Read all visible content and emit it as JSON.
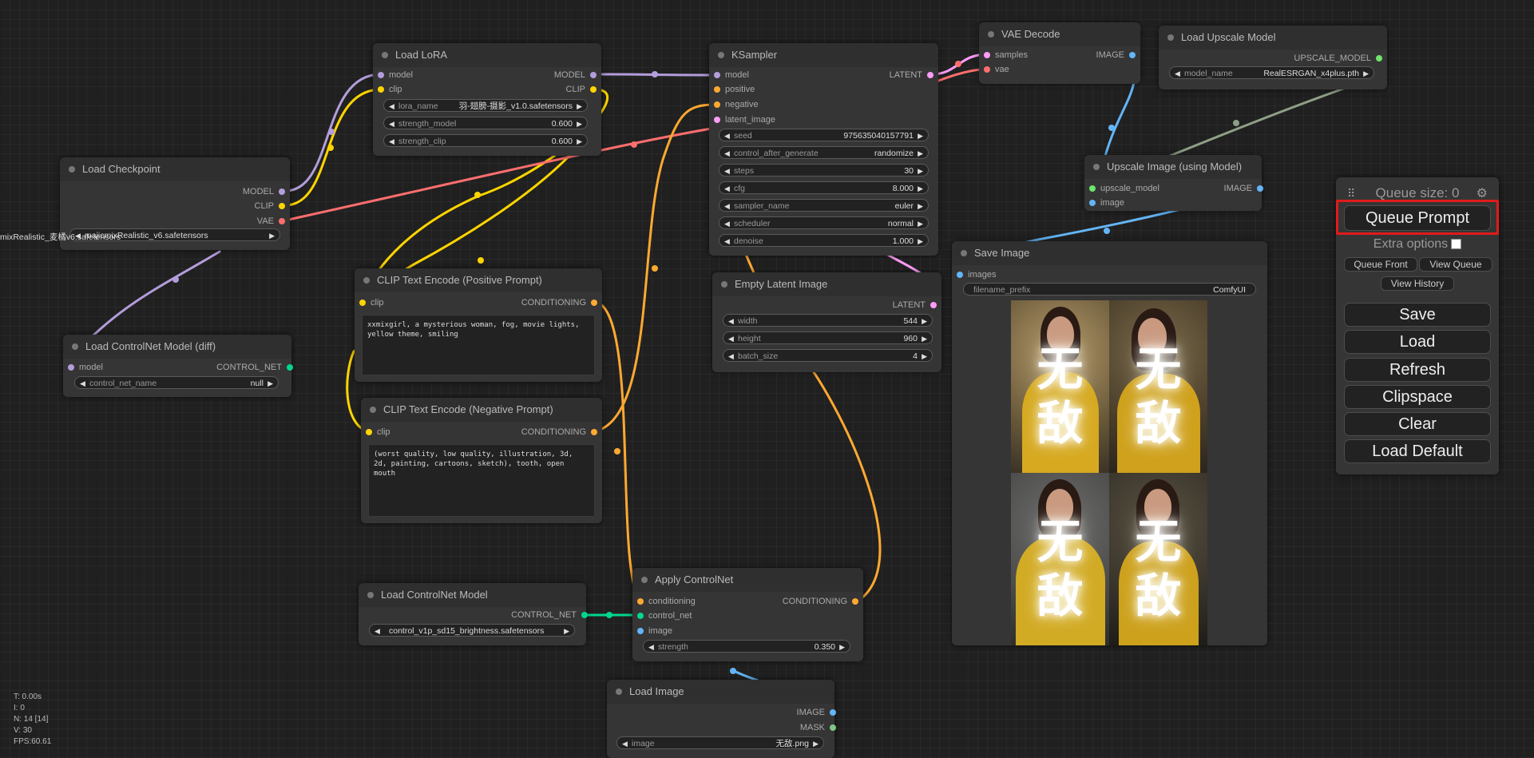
{
  "colors": {
    "model": "#b39ddb",
    "clip": "#ffd500",
    "vae": "#ff6e6e",
    "conditioning": "#ffa931",
    "latent": "#ff9cf9",
    "image": "#64b5f6",
    "mask": "#81c784",
    "control_net": "#00d78d",
    "upscale_model": "#6ee56e",
    "highlight": "#e01b1b"
  },
  "nodes": {
    "load_lora": {
      "title": "Load LoRA",
      "inputs": [
        "model",
        "clip"
      ],
      "outputs": [
        "MODEL",
        "CLIP"
      ],
      "widgets": [
        {
          "label": "lora_name",
          "value": "羽-翅膀-摄影_v1.0.safetensors"
        },
        {
          "label": "strength_model",
          "value": "0.600"
        },
        {
          "label": "strength_clip",
          "value": "0.600"
        }
      ]
    },
    "ksampler": {
      "title": "KSampler",
      "inputs": [
        "model",
        "positive",
        "negative",
        "latent_image"
      ],
      "outputs": [
        "LATENT"
      ],
      "widgets": [
        {
          "label": "seed",
          "value": "975635040157791"
        },
        {
          "label": "control_after_generate",
          "value": "randomize"
        },
        {
          "label": "steps",
          "value": "30"
        },
        {
          "label": "cfg",
          "value": "8.000"
        },
        {
          "label": "sampler_name",
          "value": "euler"
        },
        {
          "label": "scheduler",
          "value": "normal"
        },
        {
          "label": "denoise",
          "value": "1.000"
        }
      ]
    },
    "vae_decode": {
      "title": "VAE Decode",
      "inputs": [
        "samples",
        "vae"
      ],
      "outputs": [
        "IMAGE"
      ]
    },
    "load_upscale_model": {
      "title": "Load Upscale Model",
      "outputs": [
        "UPSCALE_MODEL"
      ],
      "widgets": [
        {
          "label": "model_name",
          "value": "RealESRGAN_x4plus.pth"
        }
      ]
    },
    "upscale_image": {
      "title": "Upscale Image (using Model)",
      "inputs": [
        "upscale_model",
        "image"
      ],
      "outputs": [
        "IMAGE"
      ]
    },
    "load_checkpoint": {
      "title": "Load Checkpoint",
      "outputs": [
        "MODEL",
        "CLIP",
        "VAE"
      ],
      "widgets": [
        {
          "label": "",
          "value": "majicmixRealistic_v6.safetensors"
        }
      ],
      "overflow_label": "mixRealistic_麦橘v6.safetensors"
    },
    "load_controlnet_diff": {
      "title": "Load ControlNet Model (diff)",
      "inputs": [
        "model"
      ],
      "outputs": [
        "CONTROL_NET"
      ],
      "widgets": [
        {
          "label": "control_net_name",
          "value": "null"
        }
      ]
    },
    "clip_pos": {
      "title": "CLIP Text Encode (Positive Prompt)",
      "inputs": [
        "clip"
      ],
      "outputs": [
        "CONDITIONING"
      ],
      "text": "xxmixgirl, a mysterious woman, fog, movie lights, yellow theme, smiling"
    },
    "clip_neg": {
      "title": "CLIP Text Encode (Negative Prompt)",
      "inputs": [
        "clip"
      ],
      "outputs": [
        "CONDITIONING"
      ],
      "text": "(worst quality, low quality, illustration, 3d, 2d, painting, cartoons, sketch), tooth, open mouth"
    },
    "empty_latent": {
      "title": "Empty Latent Image",
      "outputs": [
        "LATENT"
      ],
      "widgets": [
        {
          "label": "width",
          "value": "544"
        },
        {
          "label": "height",
          "value": "960"
        },
        {
          "label": "batch_size",
          "value": "4"
        }
      ]
    },
    "save_image": {
      "title": "Save Image",
      "inputs": [
        "images"
      ],
      "widgets": [
        {
          "label": "filename_prefix",
          "value": "ComfyUI"
        }
      ],
      "preview_glyphs": [
        "无",
        "敌"
      ]
    },
    "load_controlnet": {
      "title": "Load ControlNet Model",
      "outputs": [
        "CONTROL_NET"
      ],
      "widgets": [
        {
          "label": "control_net_name",
          "value": "control_v1p_sd15_brightness.safetensors"
        }
      ]
    },
    "apply_controlnet": {
      "title": "Apply ControlNet",
      "inputs": [
        "conditioning",
        "control_net",
        "image"
      ],
      "outputs": [
        "CONDITIONING"
      ],
      "widgets": [
        {
          "label": "strength",
          "value": "0.350"
        }
      ]
    },
    "load_image": {
      "title": "Load Image",
      "outputs": [
        "IMAGE",
        "MASK"
      ],
      "widgets": [
        {
          "label": "image",
          "value": "无敌.png"
        }
      ]
    }
  },
  "menu": {
    "queue_size": "Queue size: 0",
    "queue_prompt": "Queue Prompt",
    "extra_options": "Extra options",
    "queue_front": "Queue Front",
    "view_queue": "View Queue",
    "view_history": "View History",
    "save": "Save",
    "load": "Load",
    "refresh": "Refresh",
    "clipspace": "Clipspace",
    "clear": "Clear",
    "load_default": "Load Default"
  },
  "stats": [
    "T: 0.00s",
    "I: 0",
    "N: 14 [14]",
    "V: 30",
    "FPS:60.61"
  ]
}
